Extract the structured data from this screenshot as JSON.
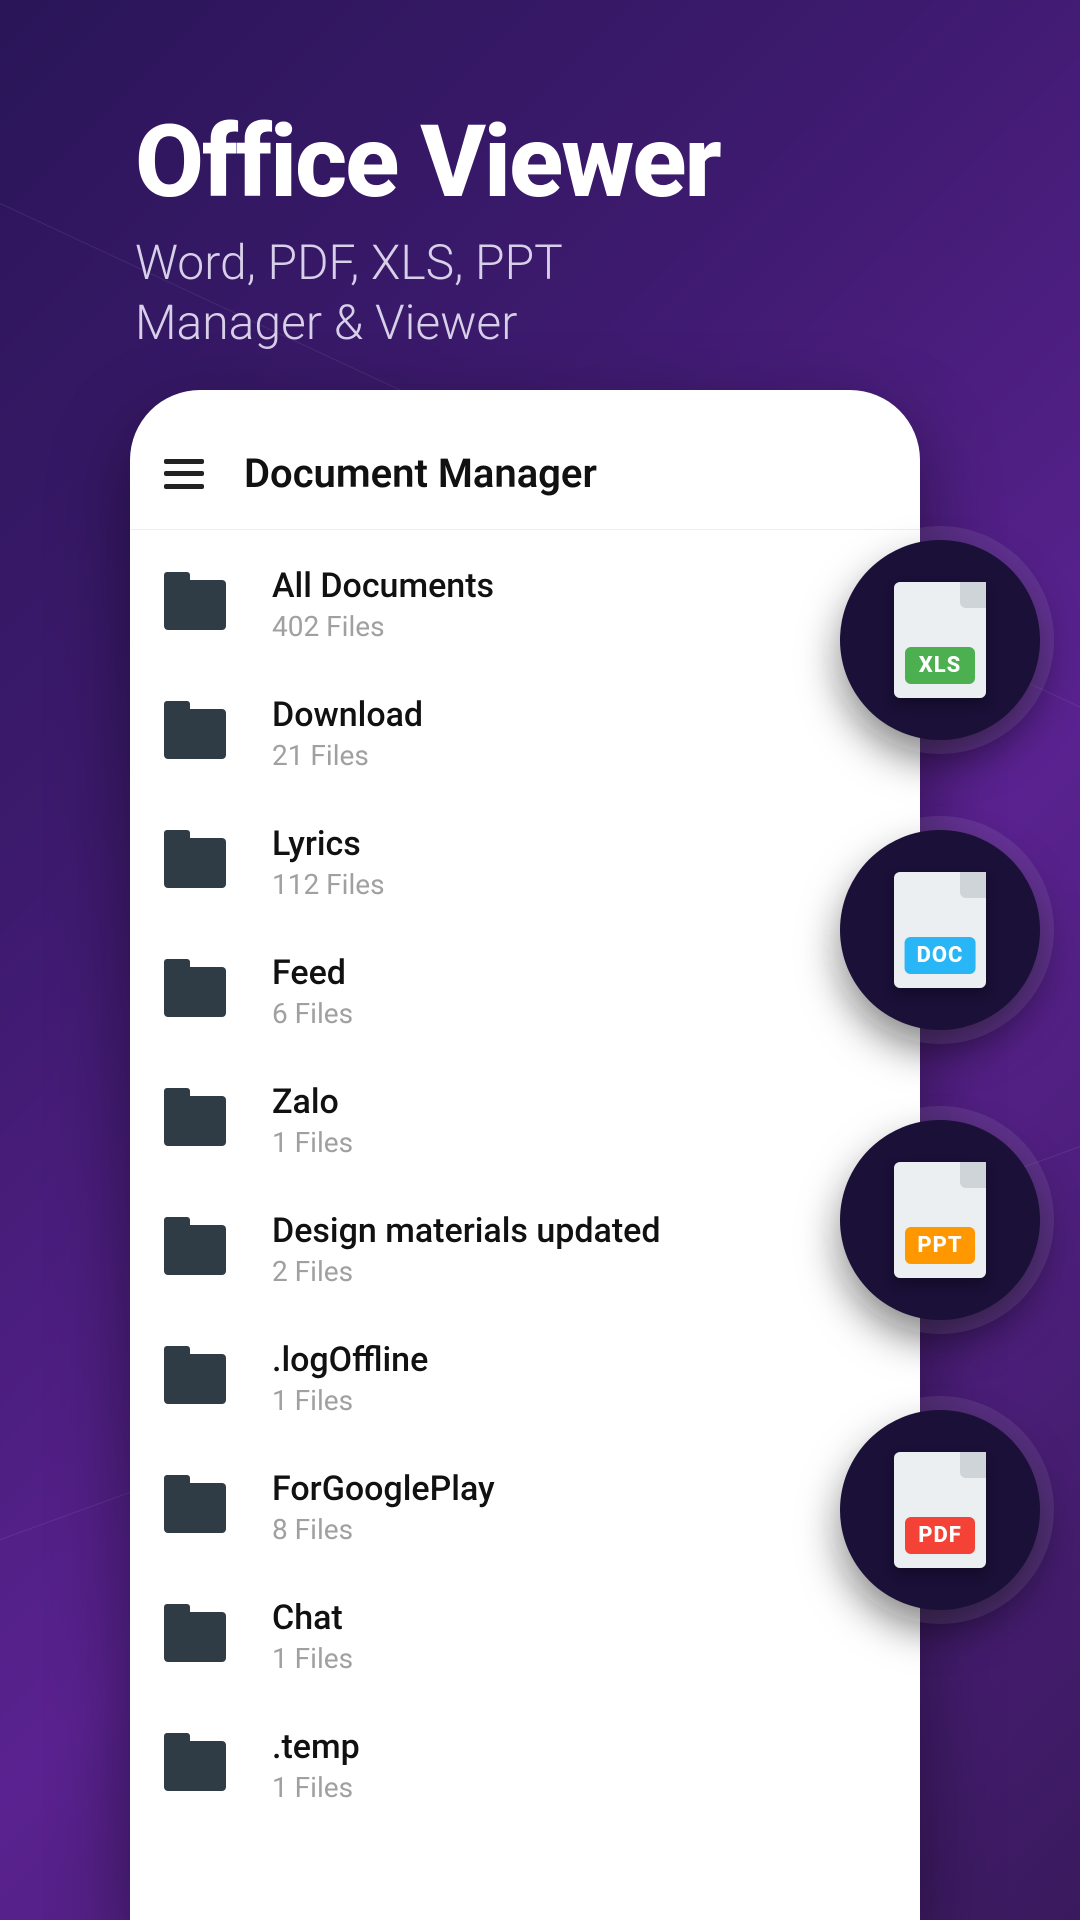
{
  "hero": {
    "title": "Office Viewer",
    "subtitle_line1": "Word, PDF, XLS, PPT",
    "subtitle_line2": "Manager & Viewer"
  },
  "appbar": {
    "title": "Document Manager"
  },
  "folders": [
    {
      "name": "All Documents",
      "sub": "402 Files"
    },
    {
      "name": "Download",
      "sub": "21 Files"
    },
    {
      "name": "Lyrics",
      "sub": "112 Files"
    },
    {
      "name": "Feed",
      "sub": "6 Files"
    },
    {
      "name": "Zalo",
      "sub": "1 Files"
    },
    {
      "name": "Design materials updated",
      "sub": "2 Files"
    },
    {
      "name": ".logOffline",
      "sub": "1 Files"
    },
    {
      "name": "ForGooglePlay",
      "sub": "8 Files"
    },
    {
      "name": "Chat",
      "sub": "1 Files"
    },
    {
      "name": ".temp",
      "sub": "1 Files"
    }
  ],
  "badges": [
    {
      "label": "XLS",
      "cls": "xls"
    },
    {
      "label": "DOC",
      "cls": "doc"
    },
    {
      "label": "PPT",
      "cls": "ppt"
    },
    {
      "label": "PDF",
      "cls": "pdf"
    }
  ]
}
